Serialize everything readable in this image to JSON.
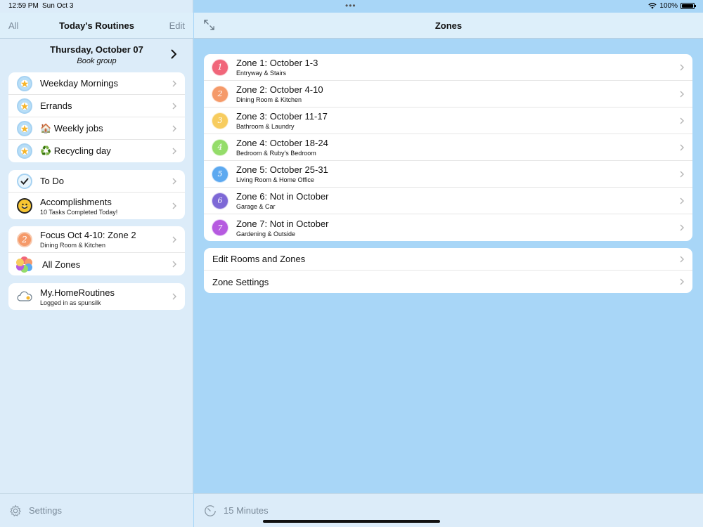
{
  "status_bar": {
    "time": "12:59 PM",
    "date": "Sun Oct 3",
    "battery": "100%"
  },
  "sidebar": {
    "nav": {
      "left": "All",
      "title": "Today's Routines",
      "right": "Edit"
    },
    "date_title": "Thursday, October 07",
    "date_subtitle": "Book group",
    "group1": [
      {
        "label": "Weekday Mornings",
        "icon": "star-icon"
      },
      {
        "label": "Errands",
        "icon": "star-icon"
      },
      {
        "label": "🏠 Weekly jobs",
        "icon": "star-icon"
      },
      {
        "label": "♻️ Recycling day",
        "icon": "star-icon"
      }
    ],
    "group2": [
      {
        "label": "To Do",
        "icon": "checkmark-icon"
      },
      {
        "label": "Accomplishments",
        "sub": "10 Tasks Completed Today!",
        "icon": "smiley-icon"
      }
    ],
    "group3": [
      {
        "label": "Focus Oct 4-10: Zone 2",
        "sub": "Dining Room & Kitchen",
        "icon": "zone-2-icon",
        "glyph": "2"
      },
      {
        "label": "All Zones",
        "icon": "all-zones-icon"
      }
    ],
    "group4": [
      {
        "label": "My.HomeRoutines",
        "sub": "Logged in as spunsilk",
        "icon": "cloud-icon"
      }
    ],
    "footer": {
      "label": "Settings",
      "icon": "gear-icon"
    }
  },
  "detail": {
    "nav": {
      "title": "Zones",
      "icon": "expand-icon"
    },
    "zones": [
      {
        "label": "Zone 1: October 1-3",
        "sub": "Entryway & Stairs",
        "glyph": "1",
        "color": "#f1667a"
      },
      {
        "label": "Zone 2: October 4-10",
        "sub": "Dining Room & Kitchen",
        "glyph": "2",
        "color": "#f59a6a"
      },
      {
        "label": "Zone 3: October 11-17",
        "sub": "Bathroom & Laundry",
        "glyph": "3",
        "color": "#f7cc5e"
      },
      {
        "label": "Zone 4: October 18-24",
        "sub": "Bedroom & Ruby's Bedroom",
        "glyph": "4",
        "color": "#94dd6a"
      },
      {
        "label": "Zone 5: October 25-31",
        "sub": "Living Room & Home Office",
        "glyph": "5",
        "color": "#5da9f0"
      },
      {
        "label": "Zone 6: Not in October",
        "sub": "Garage & Car",
        "glyph": "6",
        "color": "#7d68d6"
      },
      {
        "label": "Zone 7: Not in October",
        "sub": "Gardening & Outside",
        "glyph": "7",
        "color": "#b65be0"
      }
    ],
    "links": [
      {
        "label": "Edit Rooms and Zones"
      },
      {
        "label": "Zone Settings"
      }
    ],
    "footer": {
      "label": "15 Minutes",
      "icon": "timer-icon"
    }
  },
  "colors": {
    "accent": "#a8d6f7",
    "sidebar_bg": "#dcecf9",
    "star": "#f6b52a",
    "zone2": "#f59a6a"
  }
}
